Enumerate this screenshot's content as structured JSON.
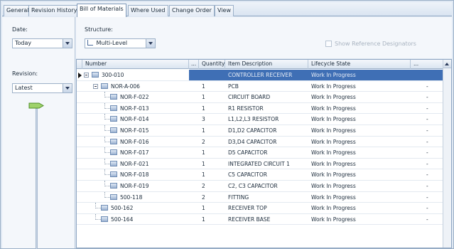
{
  "tabs": [
    {
      "label": "General"
    },
    {
      "label": "Revision History"
    },
    {
      "label": "Bill of Materials"
    },
    {
      "label": "Where Used"
    },
    {
      "label": "Change Order"
    },
    {
      "label": "View"
    }
  ],
  "filters": {
    "date_label": "Date:",
    "date_value": "Today",
    "revision_label": "Revision:",
    "revision_value": "Latest",
    "structure_label": "Structure:",
    "structure_value": "Multi-Level",
    "show_ref_label": "Show Reference Designators"
  },
  "grid": {
    "columns": {
      "number": "Number",
      "ellipsis": "...",
      "quantity": "Quantity",
      "description": "Item Description",
      "lifecycle": "Lifecycle State",
      "more": "..."
    },
    "rows": [
      {
        "number": "300-010",
        "quantity": "",
        "description": "CONTROLLER RECEIVER",
        "state": "Work In Progress",
        "flag": "",
        "level": 0,
        "expander": true,
        "selected": true
      },
      {
        "number": "NOR-A-006",
        "quantity": "1",
        "description": "PCB",
        "state": "Work In Progress",
        "flag": "-",
        "level": 1,
        "expander": true,
        "selected": false
      },
      {
        "number": "NOR-F-022",
        "quantity": "1",
        "description": "CIRCUIT BOARD",
        "state": "Work In Progress",
        "flag": "-",
        "level": 2,
        "expander": false,
        "selected": false
      },
      {
        "number": "NOR-F-013",
        "quantity": "1",
        "description": "R1 RESISTOR",
        "state": "Work In Progress",
        "flag": "-",
        "level": 2,
        "expander": false,
        "selected": false
      },
      {
        "number": "NOR-F-014",
        "quantity": "3",
        "description": "L1,L2,L3 RESISTOR",
        "state": "Work In Progress",
        "flag": "-",
        "level": 2,
        "expander": false,
        "selected": false
      },
      {
        "number": "NOR-F-015",
        "quantity": "1",
        "description": "D1,D2 CAPACITOR",
        "state": "Work In Progress",
        "flag": "-",
        "level": 2,
        "expander": false,
        "selected": false
      },
      {
        "number": "NOR-F-016",
        "quantity": "2",
        "description": "D3,D4 CAPACITOR",
        "state": "Work In Progress",
        "flag": "-",
        "level": 2,
        "expander": false,
        "selected": false
      },
      {
        "number": "NOR-F-017",
        "quantity": "1",
        "description": "D5 CAPACITOR",
        "state": "Work In Progress",
        "flag": "-",
        "level": 2,
        "expander": false,
        "selected": false
      },
      {
        "number": "NOR-F-021",
        "quantity": "1",
        "description": "INTEGRATED CIRCUIT 1",
        "state": "Work In Progress",
        "flag": "-",
        "level": 2,
        "expander": false,
        "selected": false
      },
      {
        "number": "NOR-F-018",
        "quantity": "1",
        "description": "C5 CAPACITOR",
        "state": "Work In Progress",
        "flag": "-",
        "level": 2,
        "expander": false,
        "selected": false
      },
      {
        "number": "NOR-F-019",
        "quantity": "2",
        "description": "C2, C3 CAPACITOR",
        "state": "Work In Progress",
        "flag": "-",
        "level": 2,
        "expander": false,
        "selected": false
      },
      {
        "number": "500-118",
        "quantity": "2",
        "description": "FITTING",
        "state": "Work In Progress",
        "flag": "-",
        "level": 2,
        "expander": false,
        "selected": false
      },
      {
        "number": "500-162",
        "quantity": "1",
        "description": "RECEIVER TOP",
        "state": "Work In Progress",
        "flag": "-",
        "level": 1,
        "expander": false,
        "selected": false
      },
      {
        "number": "500-164",
        "quantity": "1",
        "description": "RECEIVER BASE",
        "state": "Work In Progress",
        "flag": "-",
        "level": 1,
        "expander": false,
        "selected": false
      }
    ]
  },
  "colors": {
    "selection": "#3f6fb5",
    "panel": "#f4f7fb",
    "frame": "#dfe8f3"
  }
}
